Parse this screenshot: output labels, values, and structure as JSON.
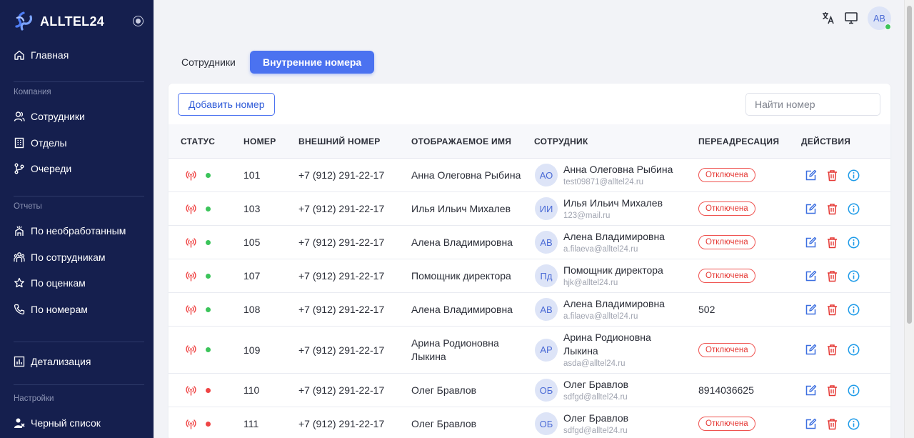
{
  "app": {
    "name": "ALLTEL24"
  },
  "sidebar": {
    "main_item": {
      "label": "Главная",
      "icon": "home-icon"
    },
    "company_title": "Компания",
    "company_items": [
      {
        "label": "Сотрудники",
        "icon": "users-icon"
      },
      {
        "label": "Отделы",
        "icon": "building-icon"
      },
      {
        "label": "Очереди",
        "icon": "branch-icon"
      }
    ],
    "reports_title": "Отчеты",
    "reports_items": [
      {
        "label": "По необработанным",
        "icon": "unprocessed-icon"
      },
      {
        "label": "По сотрудникам",
        "icon": "team-icon"
      },
      {
        "label": "По оценкам",
        "icon": "star-icon"
      },
      {
        "label": "По номерам",
        "icon": "phone-icon"
      }
    ],
    "details_item": {
      "label": "Детализация",
      "icon": "chart-icon"
    },
    "settings_title": "Настройки",
    "blacklist_item": {
      "label": "Черный список",
      "icon": "user-block-icon"
    }
  },
  "topbar": {
    "avatar_initials": "АВ",
    "online_color": "#3bc45a"
  },
  "tabs": [
    {
      "label": "Сотрудники",
      "active": false
    },
    {
      "label": "Внутренние номера",
      "active": true
    }
  ],
  "toolbar": {
    "add_label": "Добавить номер",
    "search_placeholder": "Найти номер"
  },
  "table": {
    "headers": {
      "status": "СТАТУС",
      "number": "НОМЕР",
      "external": "ВНЕШНИЙ НОМЕР",
      "display_name": "ОТОБРАЖАЕМОЕ ИМЯ",
      "employee": "СОТРУДНИК",
      "forwarding": "ПЕРЕАДРЕСАЦИЯ",
      "actions": "ДЕЙСТВИЯ"
    },
    "rows": [
      {
        "status": "online",
        "number": "101",
        "external": "+7 (912) 291-22-17",
        "display_name": "Анна Олеговна Рыбина",
        "initials": "АО",
        "employee": "Анна Олеговна Рыбина",
        "email": "test09871@alltel24.ru",
        "forwarding": "Отключена",
        "forwarding_off": true
      },
      {
        "status": "online",
        "number": "103",
        "external": "+7 (912) 291-22-17",
        "display_name": "Илья Ильич Михалев",
        "initials": "ИИ",
        "employee": "Илья Ильич Михалев",
        "email": "123@mail.ru",
        "forwarding": "Отключена",
        "forwarding_off": true
      },
      {
        "status": "online",
        "number": "105",
        "external": "+7 (912) 291-22-17",
        "display_name": "Алена Владимировна",
        "initials": "АВ",
        "employee": "Алена Владимировна",
        "email": "a.filaeva@alltel24.ru",
        "forwarding": "Отключена",
        "forwarding_off": true
      },
      {
        "status": "online",
        "number": "107",
        "external": "+7 (912) 291-22-17",
        "display_name": "Помощник директора",
        "initials": "Пд",
        "employee": "Помощник директора",
        "email": "hjk@alltel24.ru",
        "forwarding": "Отключена",
        "forwarding_off": true
      },
      {
        "status": "online",
        "number": "108",
        "external": "+7 (912) 291-22-17",
        "display_name": "Алена Владимировна",
        "initials": "АВ",
        "employee": "Алена Владимировна",
        "email": "a.filaeva@alltel24.ru",
        "forwarding": "502",
        "forwarding_off": false
      },
      {
        "status": "online",
        "number": "109",
        "external": "+7 (912) 291-22-17",
        "display_name_line1": "Арина Родионовна",
        "display_name_line2": "Лыкина",
        "initials": "АР",
        "employee_line1": "Арина Родионовна",
        "employee_line2": "Лыкина",
        "email": "asda@alltel24.ru",
        "forwarding": "Отключена",
        "forwarding_off": true
      },
      {
        "status": "offline",
        "number": "110",
        "external": "+7 (912) 291-22-17",
        "display_name": "Олег Бравлов",
        "initials": "ОБ",
        "employee": "Олег Бравлов",
        "email": "sdfgd@alltel24.ru",
        "forwarding": "8914036625",
        "forwarding_off": false
      },
      {
        "status": "offline",
        "number": "111",
        "external": "+7 (912) 291-22-17",
        "display_name": "Олег Бравлов",
        "initials": "ОБ",
        "employee": "Олег Бравлов",
        "email": "sdfgd@alltel24.ru",
        "forwarding": "Отключена",
        "forwarding_off": true
      }
    ]
  },
  "colors": {
    "sidebar_bg": "#151f4e",
    "accent": "#4b72f0",
    "status_online": "#3bc45a",
    "status_offline": "#ef4444",
    "danger": "#e53935",
    "edit": "#3c6fe0",
    "info": "#1e9be8"
  }
}
